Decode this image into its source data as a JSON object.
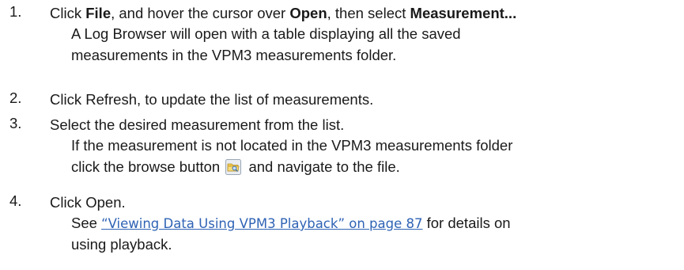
{
  "steps": [
    {
      "number": "1.",
      "text_click": "Click ",
      "file": "File",
      "text_hover": ", and hover the cursor over ",
      "open": "Open",
      "text_select": ", then select ",
      "measurement": "Measurement...",
      "sub_lines": [
        "A Log Browser will open with a table displaying all the saved",
        "measurements in the VPM3 measurements folder."
      ]
    },
    {
      "number": "2.",
      "text": "Click Refresh, to update the list of measurements."
    },
    {
      "number": "3.",
      "text": "Select the desired measurement from the list.",
      "sub_line_1": "If the measurement is not located in the VPM3 measurements folder",
      "sub_line_2_before": "click the browse button",
      "sub_line_2_after": "and navigate to the file.",
      "icon": "browse-folder-icon"
    },
    {
      "number": "4.",
      "text": "Click Open.",
      "sub_see": "See ",
      "link_text": "“Viewing Data Using VPM3 Playback” on page 87",
      "sub_after_link": " for details on",
      "sub_line_2": "using playback."
    }
  ],
  "colors": {
    "text": "#1a1a1a",
    "link": "#2f63b5"
  }
}
